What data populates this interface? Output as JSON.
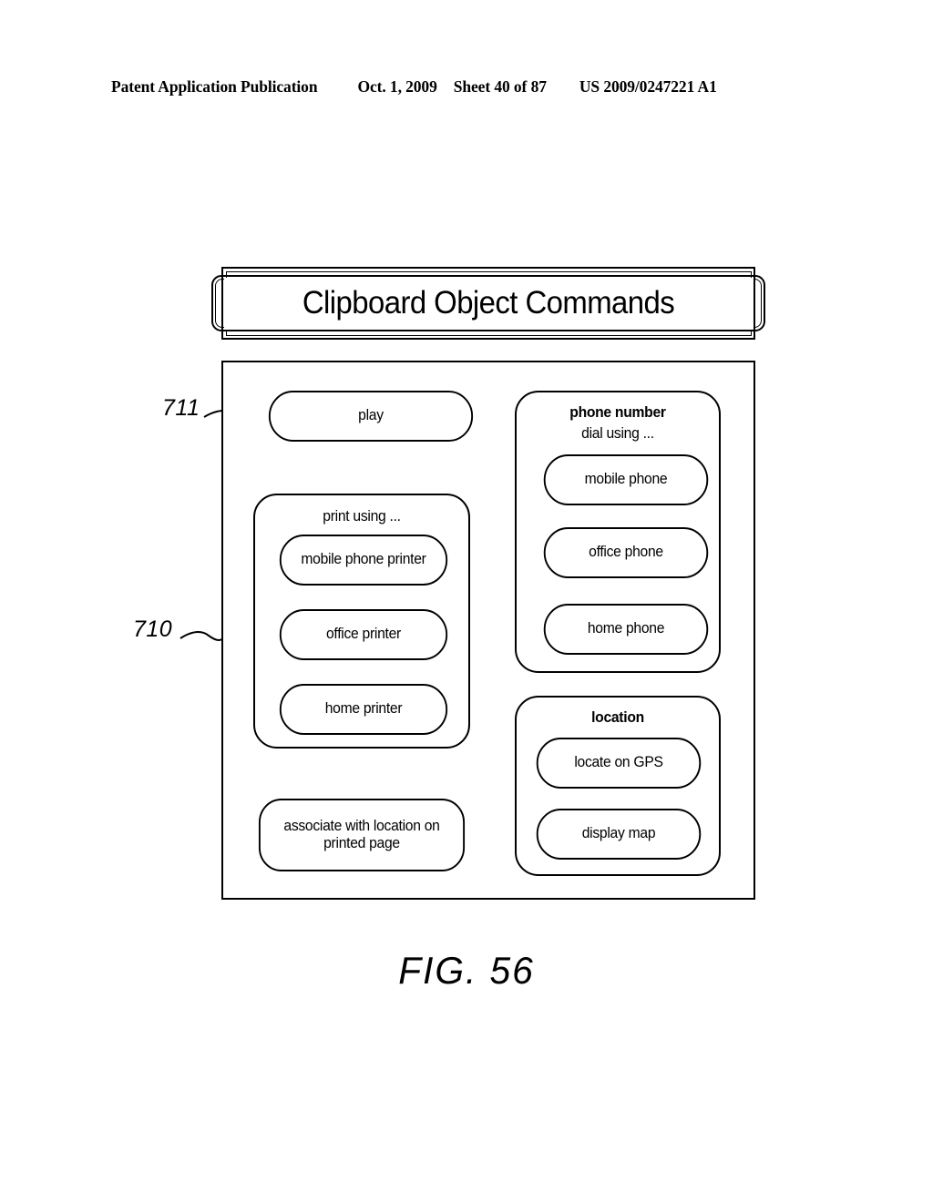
{
  "header": {
    "publication": "Patent Application Publication",
    "date": "Oct. 1, 2009",
    "sheet": "Sheet 40 of 87",
    "patent_number": "US 2009/0247221 A1"
  },
  "banner": {
    "title": "Clipboard Object Commands"
  },
  "figure": {
    "caption": "FIG. 56"
  },
  "reference_numerals": {
    "play_node": "711",
    "frame": "710"
  },
  "diagram": {
    "left_column": {
      "play": {
        "label": "play"
      },
      "print_group": {
        "title": "print using ...",
        "title_bold": false,
        "items": [
          {
            "label": "mobile phone printer"
          },
          {
            "label": "office printer"
          },
          {
            "label": "home printer"
          }
        ]
      },
      "associate": {
        "line1": "associate with location on",
        "line2": "printed page"
      }
    },
    "right_column": {
      "phone_group": {
        "title": "phone number",
        "subtitle": "dial using ...",
        "title_bold": true,
        "items": [
          {
            "label": "mobile phone"
          },
          {
            "label": "office phone"
          },
          {
            "label": "home phone"
          }
        ]
      },
      "location_group": {
        "title": "location",
        "title_bold": true,
        "items": [
          {
            "label": "locate on GPS"
          },
          {
            "label": "display map"
          }
        ]
      }
    }
  }
}
